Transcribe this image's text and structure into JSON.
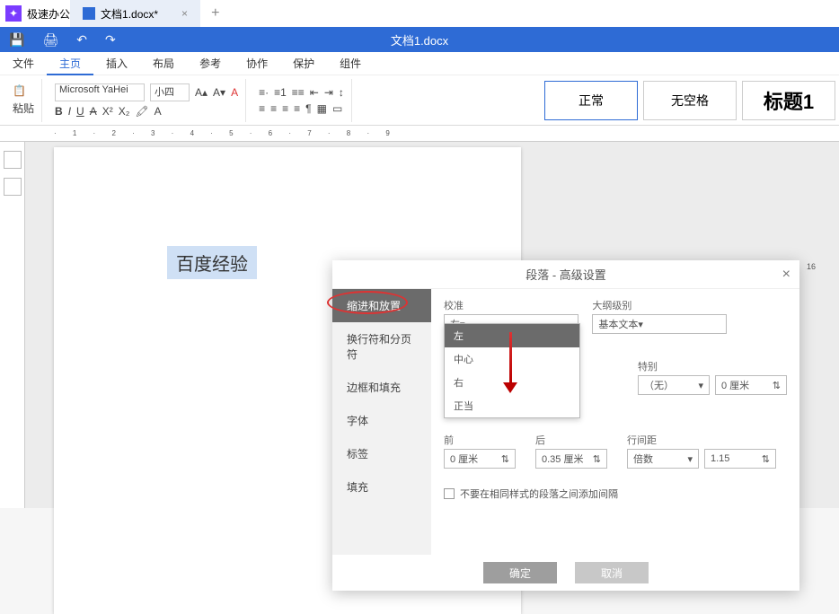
{
  "app": {
    "name": "极速办公"
  },
  "tab": {
    "label": "文档1.docx*"
  },
  "header_title": "文档1.docx",
  "menu": [
    "文件",
    "主页",
    "插入",
    "布局",
    "参考",
    "协作",
    "保护",
    "组件"
  ],
  "ribbon": {
    "paste": "粘贴",
    "font": "Microsoft YaHei",
    "size": "小四",
    "style_normal": "正常",
    "style_nospace": "无空格",
    "style_h1": "标题1"
  },
  "sel_text": "百度经验",
  "dialog": {
    "title": "段落 - 高级设置",
    "side": [
      "缩进和放置",
      "换行符和分页符",
      "边框和填充",
      "字体",
      "标签",
      "填充"
    ],
    "labels": {
      "align": "校准",
      "align_val": "左",
      "outline": "大纲级别",
      "outline_val": "基本文本",
      "special": "特别",
      "special_val": "（无）",
      "zero": "0 厘米",
      "before": "前",
      "after": "后",
      "before_v": "0 厘米",
      "after_v": "0.35 厘米",
      "line": "行间距",
      "line_mode": "倍数",
      "line_v": "1.15",
      "chk": "不要在相同样式的段落之间添加间隔"
    },
    "options": [
      "左",
      "中心",
      "右",
      "正当"
    ],
    "ok": "确定",
    "cancel": "取消"
  },
  "ruler_num": "16"
}
